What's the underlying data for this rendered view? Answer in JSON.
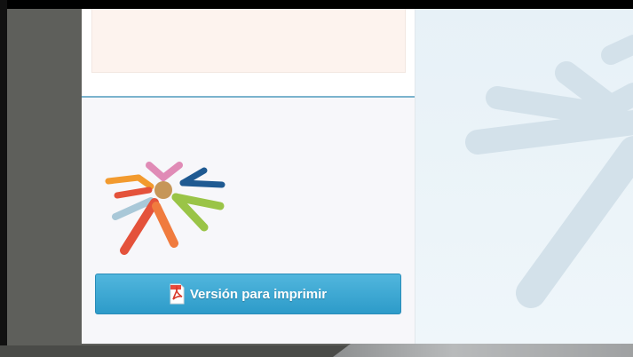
{
  "print_button": {
    "label": "Versión para imprimir",
    "icon": "pdf-icon"
  },
  "logo": {
    "icon": "star-burst-logo",
    "colors": [
      "#f29a2e",
      "#e08bb6",
      "#1f5a92",
      "#a9c8d8",
      "#e4523b",
      "#f07b3e",
      "#9ac447",
      "#c69658"
    ]
  },
  "colors": {
    "button": "#3aa8d3",
    "sidebar_divider": "#7bb3cd",
    "peach_box": "#fdf3ee"
  }
}
